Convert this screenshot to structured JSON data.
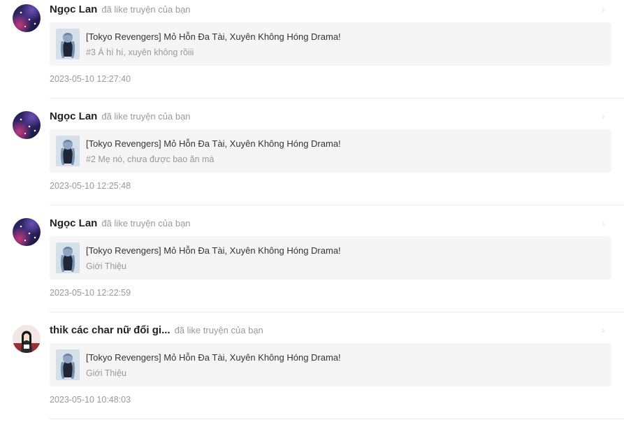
{
  "notifications": [
    {
      "user": "Ngọc Lan",
      "action": "đã like truyện của bạn",
      "story_title": "[Tokyo Revengers] Mỏ Hỗn Đa Tài, Xuyên Không Hóng Drama!",
      "chapter": "#3 Á hí hí, xuyên không rồiii",
      "timestamp": "2023-05-10 12:27:40",
      "avatar_icon": "galaxy-avatar"
    },
    {
      "user": "Ngọc Lan",
      "action": "đã like truyện của bạn",
      "story_title": "[Tokyo Revengers] Mỏ Hỗn Đa Tài, Xuyên Không Hóng Drama!",
      "chapter": "#2 Mẹ nó, chưa được bao ăn mà",
      "timestamp": "2023-05-10 12:25:48",
      "avatar_icon": "galaxy-avatar"
    },
    {
      "user": "Ngọc Lan",
      "action": "đã like truyện của bạn",
      "story_title": "[Tokyo Revengers] Mỏ Hỗn Đa Tài, Xuyên Không Hóng Drama!",
      "chapter": "Giới Thiệu",
      "timestamp": "2023-05-10 12:22:59",
      "avatar_icon": "galaxy-avatar"
    },
    {
      "user": "thik các char nữ đổi gi...",
      "action": "đã like truyện của bạn",
      "story_title": "[Tokyo Revengers] Mỏ Hỗn Đa Tài, Xuyên Không Hóng Drama!",
      "chapter": "Giới Thiệu",
      "timestamp": "2023-05-10 10:48:03",
      "avatar_icon": "girl-avatar"
    }
  ],
  "icons": {
    "chevron": "chevron-right-icon"
  },
  "colors": {
    "card_bg": "#f5f5f5",
    "muted_text": "#999999",
    "divider": "#e8e8e8"
  }
}
